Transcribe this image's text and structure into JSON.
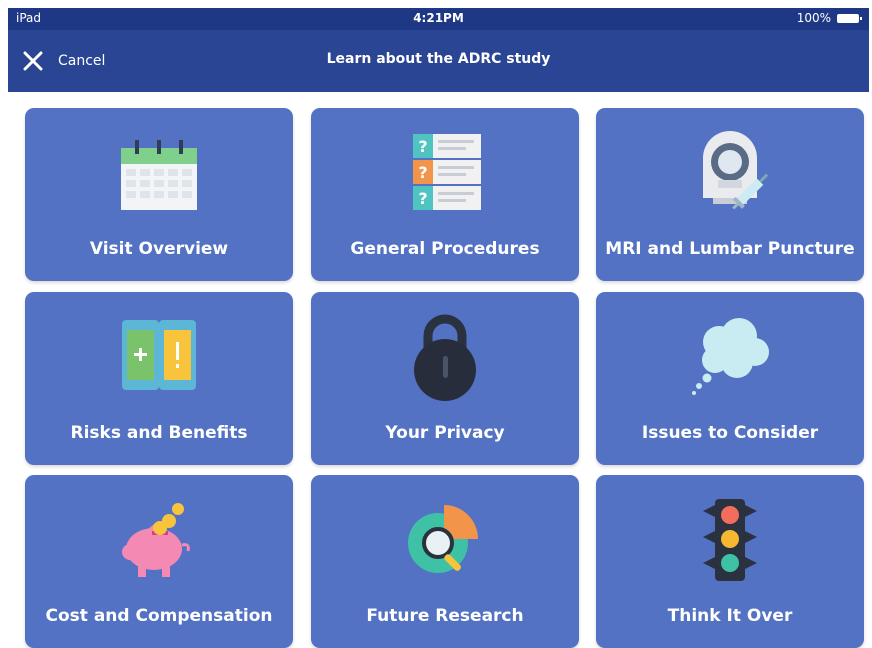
{
  "status_bar": {
    "carrier": "iPad",
    "time": "4:21PM",
    "battery": "100%"
  },
  "nav_bar": {
    "cancel_label": "Cancel",
    "title": "Learn about the ADRC study"
  },
  "tiles": [
    {
      "label": "Visit Overview",
      "icon": "calendar-icon"
    },
    {
      "label": "General Procedures",
      "icon": "question-list-icon"
    },
    {
      "label": "MRI and Lumbar Puncture",
      "icon": "mri-syringe-icon"
    },
    {
      "label": "Risks and Benefits",
      "icon": "phones-plus-exclamation-icon"
    },
    {
      "label": "Your Privacy",
      "icon": "padlock-icon"
    },
    {
      "label": "Issues to Consider",
      "icon": "thought-cloud-icon"
    },
    {
      "label": "Cost and Compensation",
      "icon": "piggy-bank-icon"
    },
    {
      "label": "Future Research",
      "icon": "chart-magnifier-icon"
    },
    {
      "label": "Think It Over",
      "icon": "traffic-light-icon"
    }
  ],
  "colors": {
    "status_bar": "#1f3886",
    "nav_bar": "#2a4594",
    "tile": "#5372c4"
  }
}
